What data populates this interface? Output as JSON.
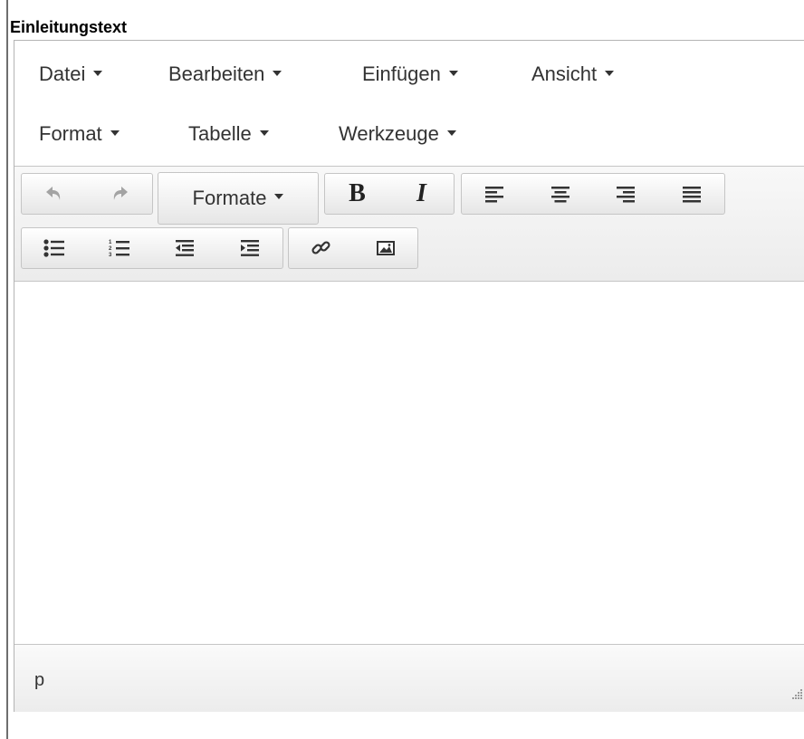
{
  "field": {
    "label": "Einleitungstext"
  },
  "menubar": {
    "items": [
      {
        "label": "Datei"
      },
      {
        "label": "Bearbeiten"
      },
      {
        "label": "Einfügen"
      },
      {
        "label": "Ansicht"
      },
      {
        "label": "Format"
      },
      {
        "label": "Tabelle"
      },
      {
        "label": "Werkzeuge"
      }
    ]
  },
  "toolbar": {
    "undo_icon": "undo-icon",
    "redo_icon": "redo-icon",
    "formats_label": "Formate",
    "bold_label": "B",
    "italic_label": "I",
    "align_icons": [
      "align-left-icon",
      "align-center-icon",
      "align-right-icon",
      "align-justify-icon"
    ],
    "list_icons": [
      "bullet-list-icon",
      "numbered-list-icon",
      "outdent-icon",
      "indent-icon"
    ],
    "insert_icons": [
      "link-icon",
      "image-icon"
    ]
  },
  "editor": {
    "content": ""
  },
  "statusbar": {
    "path": "p"
  },
  "colors": {
    "icon": "#333333",
    "disabled_icon": "#a3a3a3",
    "border": "#c5c5c5"
  }
}
